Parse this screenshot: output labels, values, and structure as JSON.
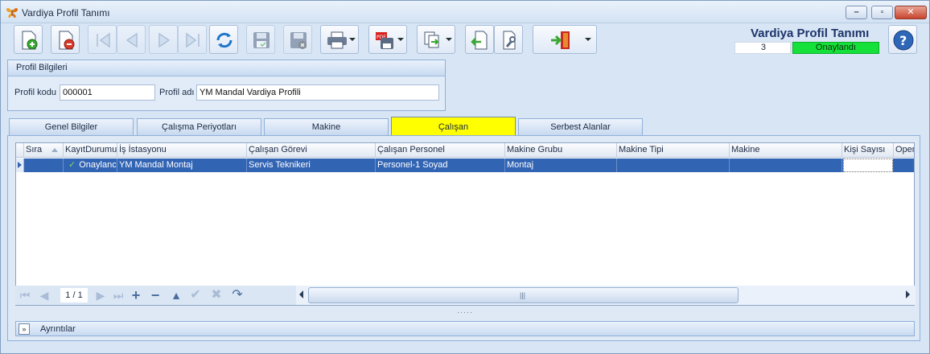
{
  "window": {
    "title": "Vardiya Profil Tanımı"
  },
  "header": {
    "title": "Vardiya Profil Tanımı",
    "record_no": "3",
    "status": "Onaylandı",
    "status_color": "#16e03a"
  },
  "profile_group": {
    "title": "Profil Bilgileri",
    "code_label": "Profil kodu",
    "code_value": "000001",
    "name_label": "Profil adı",
    "name_value": "YM Mandal Vardiya Profili"
  },
  "tabs": [
    {
      "label": "Genel Bilgiler"
    },
    {
      "label": "Çalışma Periyotları"
    },
    {
      "label": "Makine"
    },
    {
      "label": "Çalışan",
      "active": true
    },
    {
      "label": "Serbest Alanlar"
    }
  ],
  "grid": {
    "columns": [
      "Sıra",
      "KayıtDurumu",
      "İş İstasyonu",
      "Çalışan Görevi",
      "Çalışan Personel",
      "Makine Grubu",
      "Makine Tipi",
      "Makine",
      "Kişi Sayısı",
      "Oper"
    ],
    "rows": [
      {
        "sira": "",
        "durum": "Onaylanc",
        "istasyon": "YM Mandal Montaj",
        "gorev": "Servis Teknikeri",
        "personel": "Personel-1 Soyad",
        "grup": "Montaj",
        "tip": "",
        "makine": "",
        "kisi": "",
        "oper": ""
      }
    ]
  },
  "navigator": {
    "page": "1 / 1"
  },
  "details": {
    "label": "Ayrıntılar"
  }
}
